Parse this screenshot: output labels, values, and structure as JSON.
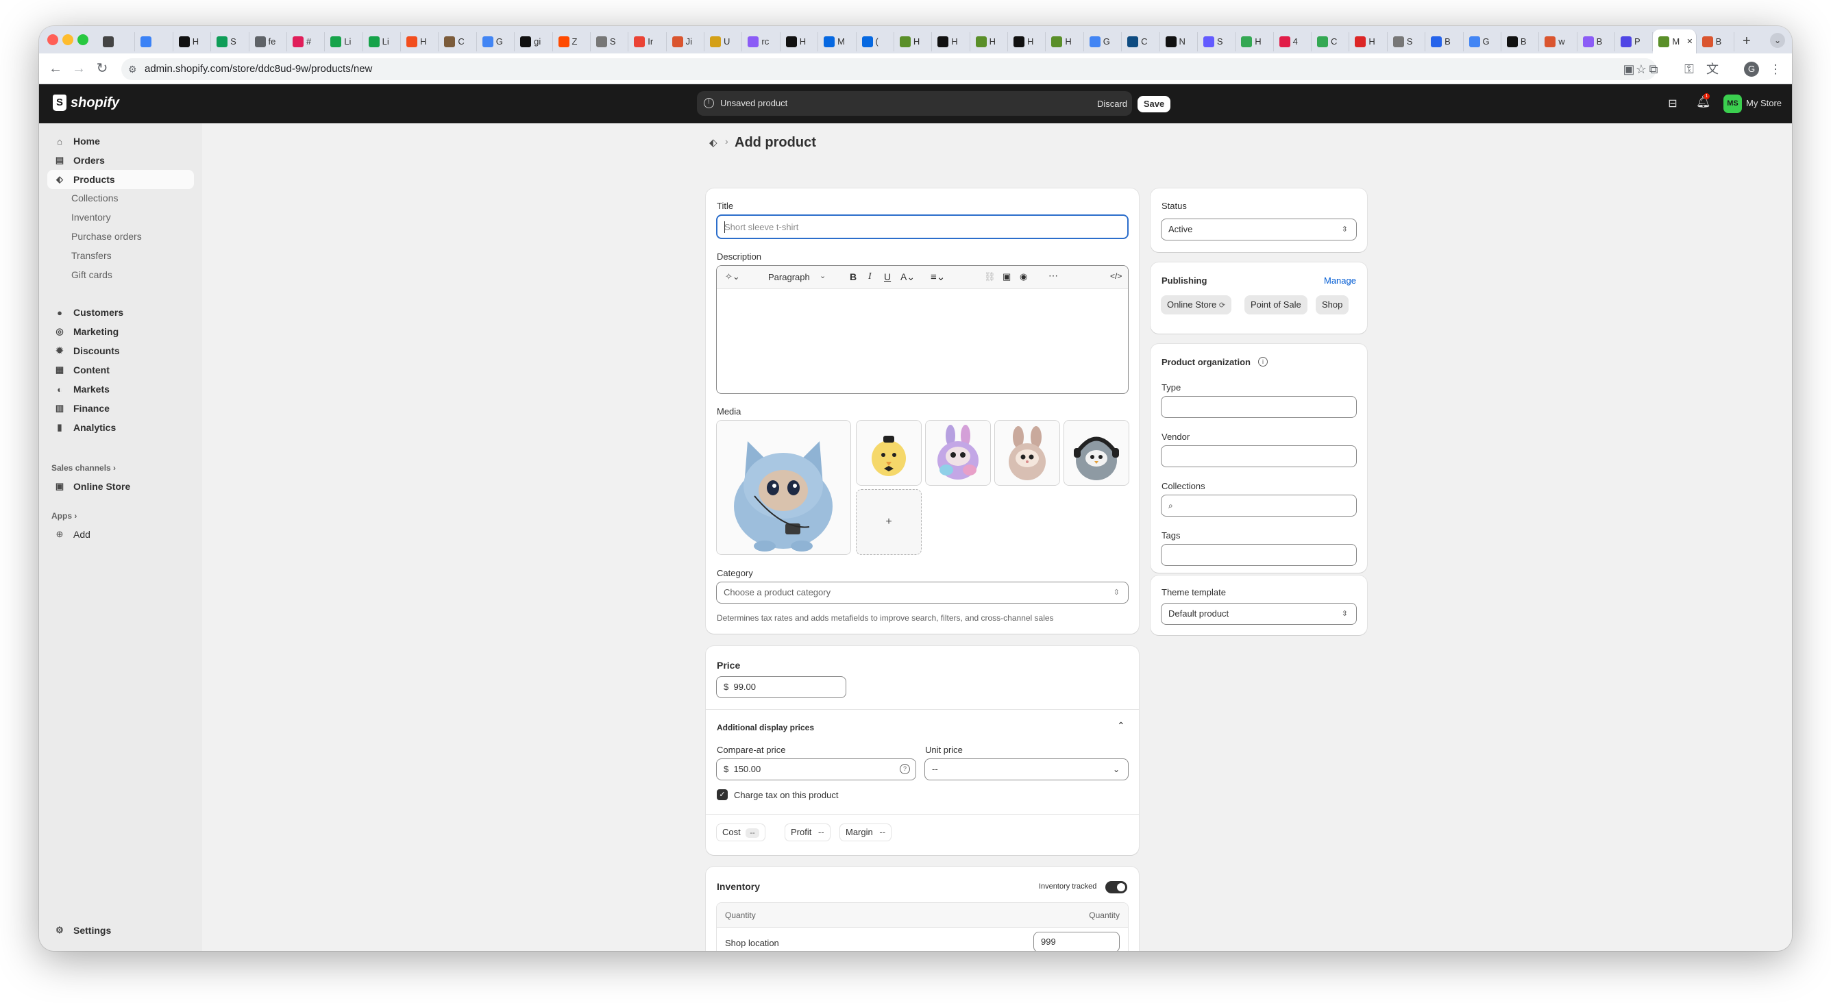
{
  "browser": {
    "url": "admin.shopify.com/store/ddc8ud-9w/products/new",
    "tabs": [
      {
        "label": "",
        "icon": "framer-icon"
      },
      {
        "label": "",
        "icon": "chrome-icon"
      },
      {
        "label": "H",
        "icon": "openai-icon"
      },
      {
        "label": "S",
        "icon": "sheets-icon"
      },
      {
        "label": "fe",
        "icon": "feather-icon"
      },
      {
        "label": "#",
        "icon": "slack-icon"
      },
      {
        "label": "Li",
        "icon": "b-icon"
      },
      {
        "label": "Li",
        "icon": "b-icon"
      },
      {
        "label": "H",
        "icon": "figma-icon"
      },
      {
        "label": "C",
        "icon": "circle-icon"
      },
      {
        "label": "G",
        "icon": "gemini-icon"
      },
      {
        "label": "gi",
        "icon": "github-icon"
      },
      {
        "label": "Z",
        "icon": "zapier-icon"
      },
      {
        "label": "S",
        "icon": "robot-icon"
      },
      {
        "label": "Ir",
        "icon": "gmail-icon"
      },
      {
        "label": "Ji",
        "icon": "product-hunt-icon"
      },
      {
        "label": "U",
        "icon": "duck-icon"
      },
      {
        "label": "rc",
        "icon": "claude-icon"
      },
      {
        "label": "H",
        "icon": "openai-icon"
      },
      {
        "label": "M",
        "icon": "meta-icon"
      },
      {
        "label": "(",
        "icon": "meta-icon"
      },
      {
        "label": "H",
        "icon": "shopify-icon"
      },
      {
        "label": "H",
        "icon": "openai-icon"
      },
      {
        "label": "H",
        "icon": "shopify-icon"
      },
      {
        "label": "H",
        "icon": "notion-icon"
      },
      {
        "label": "H",
        "icon": "shopify-icon"
      },
      {
        "label": "G",
        "icon": "chrome-icon"
      },
      {
        "label": "C",
        "icon": "vscode-icon"
      },
      {
        "label": "N",
        "icon": "notion-icon"
      },
      {
        "label": "S",
        "icon": "stripe-icon"
      },
      {
        "label": "H",
        "icon": "drive-icon"
      },
      {
        "label": "4",
        "icon": "sk-icon"
      },
      {
        "label": "C",
        "icon": "drive-icon"
      },
      {
        "label": "H",
        "icon": "h-icon"
      },
      {
        "label": "S",
        "icon": "robot-icon"
      },
      {
        "label": "B",
        "icon": "b-icon"
      },
      {
        "label": "G",
        "icon": "chrome-icon"
      },
      {
        "label": "B",
        "icon": "notion-icon"
      },
      {
        "label": "w",
        "icon": "product-hunt-icon"
      },
      {
        "label": "B",
        "icon": "apps-icon"
      },
      {
        "label": "P",
        "icon": "p-icon"
      },
      {
        "label": "M",
        "icon": "shopify-icon",
        "active": true
      },
      {
        "label": "B",
        "icon": "product-hunt-icon"
      }
    ]
  },
  "topbar": {
    "brand": "shopify",
    "unsaved_label": "Unsaved product",
    "discard_label": "Discard",
    "save_label": "Save",
    "store_initials": "MS",
    "store_name": "My Store",
    "notification_count": "1"
  },
  "sidebar": {
    "items": [
      {
        "label": "Home",
        "icon": "home-icon"
      },
      {
        "label": "Orders",
        "icon": "orders-icon"
      },
      {
        "label": "Products",
        "icon": "tag-icon",
        "active": true
      },
      {
        "label": "Customers",
        "icon": "person-icon"
      },
      {
        "label": "Marketing",
        "icon": "target-icon"
      },
      {
        "label": "Discounts",
        "icon": "discount-icon"
      },
      {
        "label": "Content",
        "icon": "content-icon"
      },
      {
        "label": "Markets",
        "icon": "globe-icon"
      },
      {
        "label": "Finance",
        "icon": "bank-icon"
      },
      {
        "label": "Analytics",
        "icon": "chart-icon"
      }
    ],
    "product_sub": [
      "Collections",
      "Inventory",
      "Purchase orders",
      "Transfers",
      "Gift cards"
    ],
    "sales_channels_label": "Sales channels",
    "online_store_label": "Online Store",
    "apps_label": "Apps",
    "add_label": "Add",
    "settings_label": "Settings"
  },
  "page": {
    "title": "Add product",
    "title_field_label": "Title",
    "title_placeholder": "Short sleeve t-shirt",
    "description_label": "Description",
    "paragraph_label": "Paragraph",
    "media_label": "Media",
    "media_items": [
      "blue-cat-plush",
      "yellow-chick-plush",
      "purple-bunny-plush",
      "pink-bunny-plush",
      "grey-penguin-plush"
    ],
    "add_media_label": "+",
    "category_label": "Category",
    "category_placeholder": "Choose a product category",
    "category_help": "Determines tax rates and adds metafields to improve search, filters, and cross-channel sales",
    "price_label": "Price",
    "currency": "$",
    "price_value": "99.00",
    "additional_prices_label": "Additional display prices",
    "compare_label": "Compare-at price",
    "compare_value": "150.00",
    "unit_price_label": "Unit price",
    "unit_price_value": "--",
    "charge_tax_label": "Charge tax on this product",
    "charge_tax_checked": true,
    "cost_label": "Cost",
    "cost_value": "--",
    "profit_label": "Profit",
    "profit_value": "--",
    "margin_label": "Margin",
    "margin_value": "--",
    "inventory_label": "Inventory",
    "inventory_tracked_label": "Inventory tracked",
    "inventory_tracked_on": true,
    "quantity_header_left": "Quantity",
    "quantity_header_right": "Quantity",
    "location_label": "Shop location",
    "location_quantity": "999"
  },
  "right": {
    "status_label": "Status",
    "status_value": "Active",
    "publishing_label": "Publishing",
    "manage_label": "Manage",
    "channels": [
      "Online Store",
      "Point of Sale",
      "Shop"
    ],
    "org_label": "Product organization",
    "type_label": "Type",
    "vendor_label": "Vendor",
    "collections_label": "Collections",
    "tags_label": "Tags",
    "theme_label": "Theme template",
    "theme_value": "Default product"
  },
  "colors": {
    "topbar": "#1a1a1a",
    "accent_link": "#005bd3",
    "focus": "#2c6ecb",
    "store_avatar": "#3bcf4f"
  }
}
